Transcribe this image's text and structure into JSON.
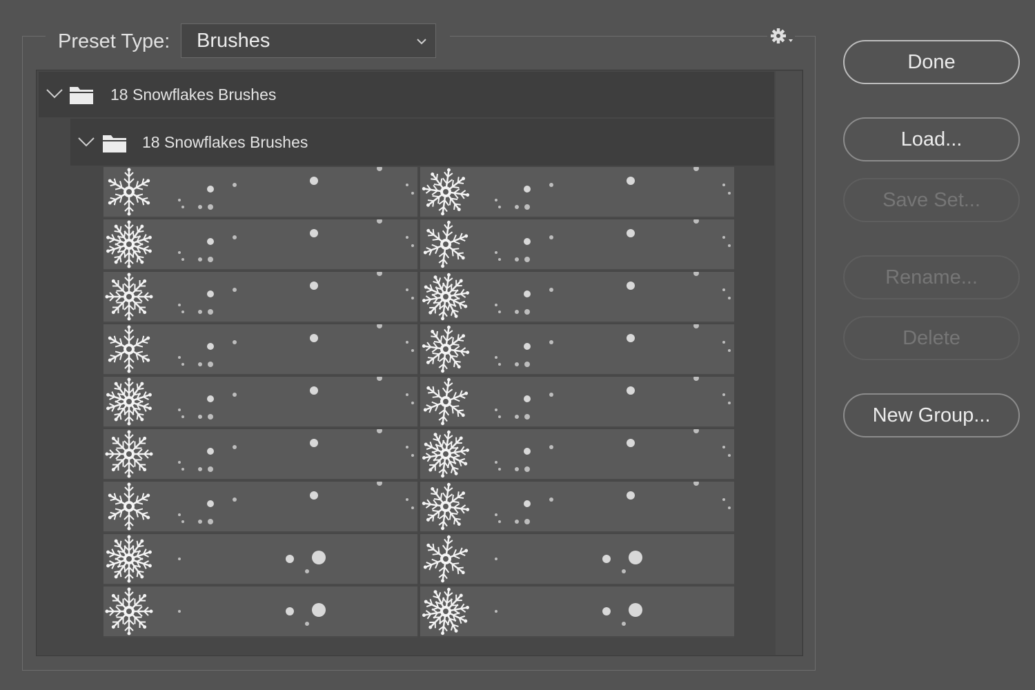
{
  "preset": {
    "label": "Preset Type:",
    "value": "Brushes"
  },
  "tree": {
    "group_label": "18 Snowflakes Brushes",
    "subgroup_label": "18 Snowflakes Brushes"
  },
  "brushes": {
    "count": 18,
    "columns": 2
  },
  "buttons": {
    "done": "Done",
    "load": "Load...",
    "save_set": "Save Set...",
    "rename": "Rename...",
    "delete": "Delete",
    "new_group": "New Group..."
  },
  "icons": {
    "menu": "gear-icon",
    "expand": "chevron-down-icon",
    "folder": "folder-icon",
    "brush": "snowflake-icon"
  },
  "colors": {
    "background": "#535353",
    "list_background": "#474747",
    "group_row": "#3e3e3e",
    "thumbnail": "#5a5a5a",
    "button_text_disabled": "#767676"
  }
}
